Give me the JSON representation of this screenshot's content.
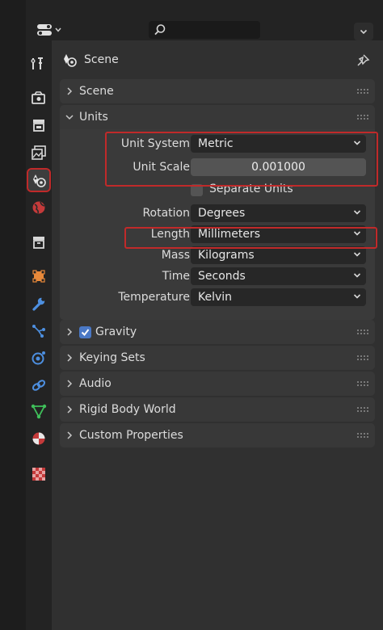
{
  "header": {
    "title": "Scene",
    "icon": "scene-icon"
  },
  "sidebar": {
    "tabs": [
      {
        "name": "tool-tab",
        "icon": "tool-icon"
      },
      {
        "name": "render-tab",
        "icon": "render-icon"
      },
      {
        "name": "output-tab",
        "icon": "output-icon"
      },
      {
        "name": "view-layer-tab",
        "icon": "view-layer-icon"
      },
      {
        "name": "scene-tab",
        "icon": "scene-icon",
        "active": true
      },
      {
        "name": "world-tab",
        "icon": "world-icon"
      },
      {
        "name": "collection-tab",
        "icon": "collection-icon"
      },
      {
        "name": "object-tab",
        "icon": "object-icon"
      },
      {
        "name": "modifier-tab",
        "icon": "wrench-icon"
      },
      {
        "name": "particles-tab",
        "icon": "particles-icon"
      },
      {
        "name": "physics-tab",
        "icon": "physics-icon"
      },
      {
        "name": "constraints-tab",
        "icon": "constraints-icon"
      },
      {
        "name": "data-tab",
        "icon": "vertex-data-icon"
      },
      {
        "name": "material-tab",
        "icon": "material-icon"
      },
      {
        "name": "texture-tab",
        "icon": "texture-icon"
      }
    ]
  },
  "panels": {
    "scene": {
      "label": "Scene"
    },
    "units": {
      "label": "Units",
      "unit_system_label": "Unit System",
      "unit_system_value": "Metric",
      "unit_scale_label": "Unit Scale",
      "unit_scale_value": "0.001000",
      "separate_units_label": "Separate Units",
      "separate_units_checked": false,
      "rotation_label": "Rotation",
      "rotation_value": "Degrees",
      "length_label": "Length",
      "length_value": "Millimeters",
      "mass_label": "Mass",
      "mass_value": "Kilograms",
      "time_label": "Time",
      "time_value": "Seconds",
      "temperature_label": "Temperature",
      "temperature_value": "Kelvin"
    },
    "gravity": {
      "label": "Gravity",
      "checked": true
    },
    "keying_sets": {
      "label": "Keying Sets"
    },
    "audio": {
      "label": "Audio"
    },
    "rigid_body_world": {
      "label": "Rigid Body World"
    },
    "custom_properties": {
      "label": "Custom Properties"
    }
  },
  "colors": {
    "highlight": "#c02a2a",
    "checkbox_active": "#4a78c5",
    "panel": "#383838",
    "background": "#303030"
  }
}
